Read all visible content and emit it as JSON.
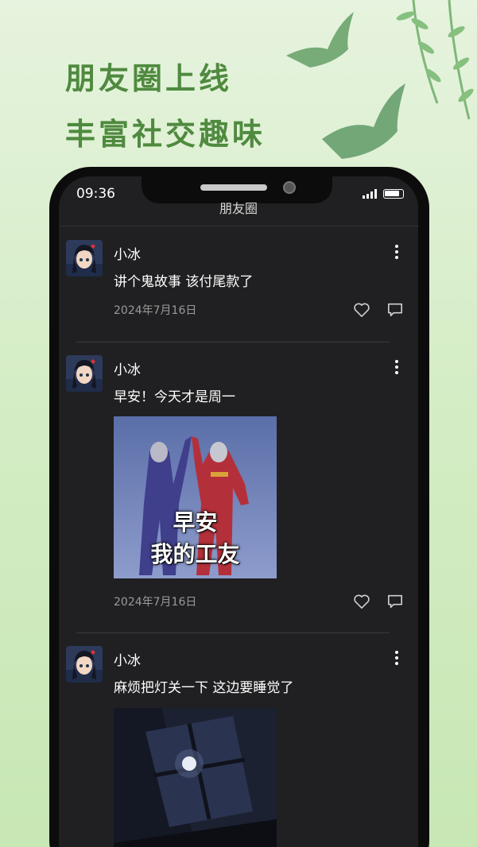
{
  "promo": {
    "headline_1": "朋友圈上线",
    "headline_2": "丰富社交趣味"
  },
  "status_bar": {
    "time": "09:36"
  },
  "screen": {
    "title": "朋友圈"
  },
  "posts": [
    {
      "username": "小冰",
      "text": "讲个鬼故事 该付尾款了",
      "date": "2024年7月16日"
    },
    {
      "username": "小冰",
      "text": "早安！今天才是周一",
      "date": "2024年7月16日",
      "image_caption_1": "早安",
      "image_caption_2": "我的工友"
    },
    {
      "username": "小冰",
      "text": "麻烦把灯关一下 这边要睡觉了"
    }
  ],
  "colors": {
    "background_green": "#d5edc6",
    "headline_green": "#4f8a3f",
    "screen_dark": "#202022"
  }
}
